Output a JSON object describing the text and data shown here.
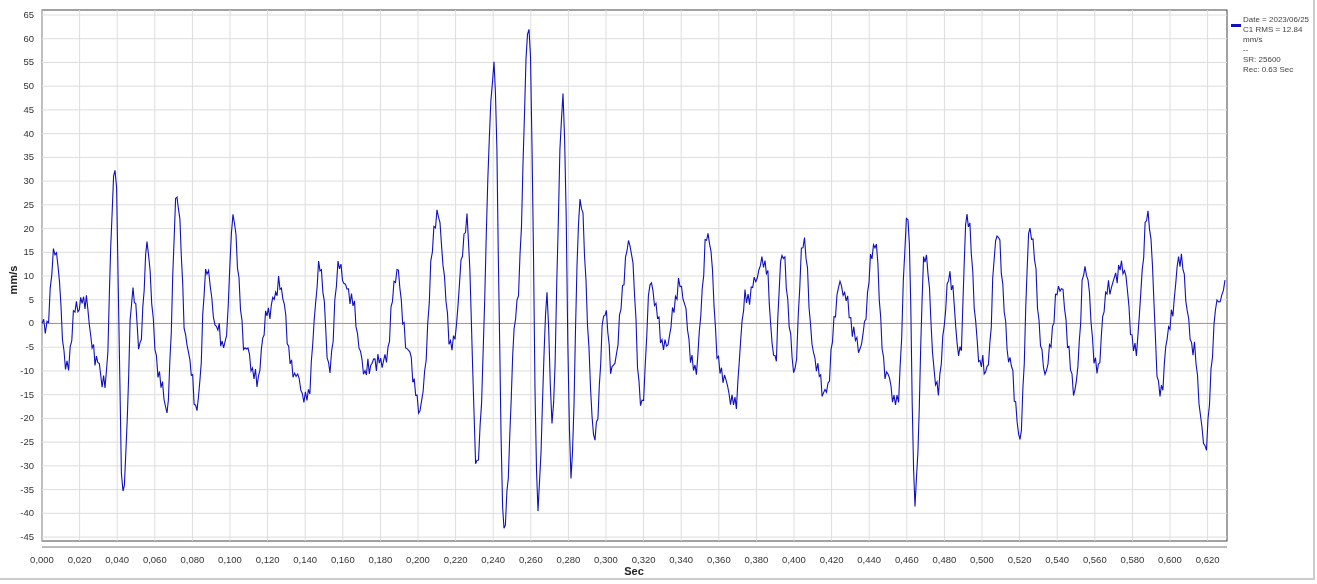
{
  "chart": {
    "ylabel": "mm/s",
    "xlabel": "Sec",
    "yticks": [
      "65",
      "60",
      "55",
      "50",
      "45",
      "40",
      "35",
      "30",
      "25",
      "20",
      "15",
      "10",
      "5",
      "0",
      "-5",
      "-10",
      "-15",
      "-20",
      "-25",
      "-30",
      "-35",
      "-40",
      "-45"
    ],
    "xticks": [
      "0,000",
      "0,020",
      "0,040",
      "0,060",
      "0,080",
      "0,100",
      "0,120",
      "0,140",
      "0,160",
      "0,180",
      "0,200",
      "0,220",
      "0,240",
      "0,260",
      "0,280",
      "0,300",
      "0,320",
      "0,340",
      "0,360",
      "0,380",
      "0,400",
      "0,420",
      "0,440",
      "0,460",
      "0,480",
      "0,500",
      "0,520",
      "0,540",
      "0,560",
      "0,580",
      "0,600",
      "0,620"
    ]
  },
  "legend": {
    "lines": [
      "Date = 2023/06/25",
      "C1 RMS = 12.84 mm/s",
      "--",
      "SR: 25600",
      "Rec: 0.63 Sec"
    ]
  }
}
